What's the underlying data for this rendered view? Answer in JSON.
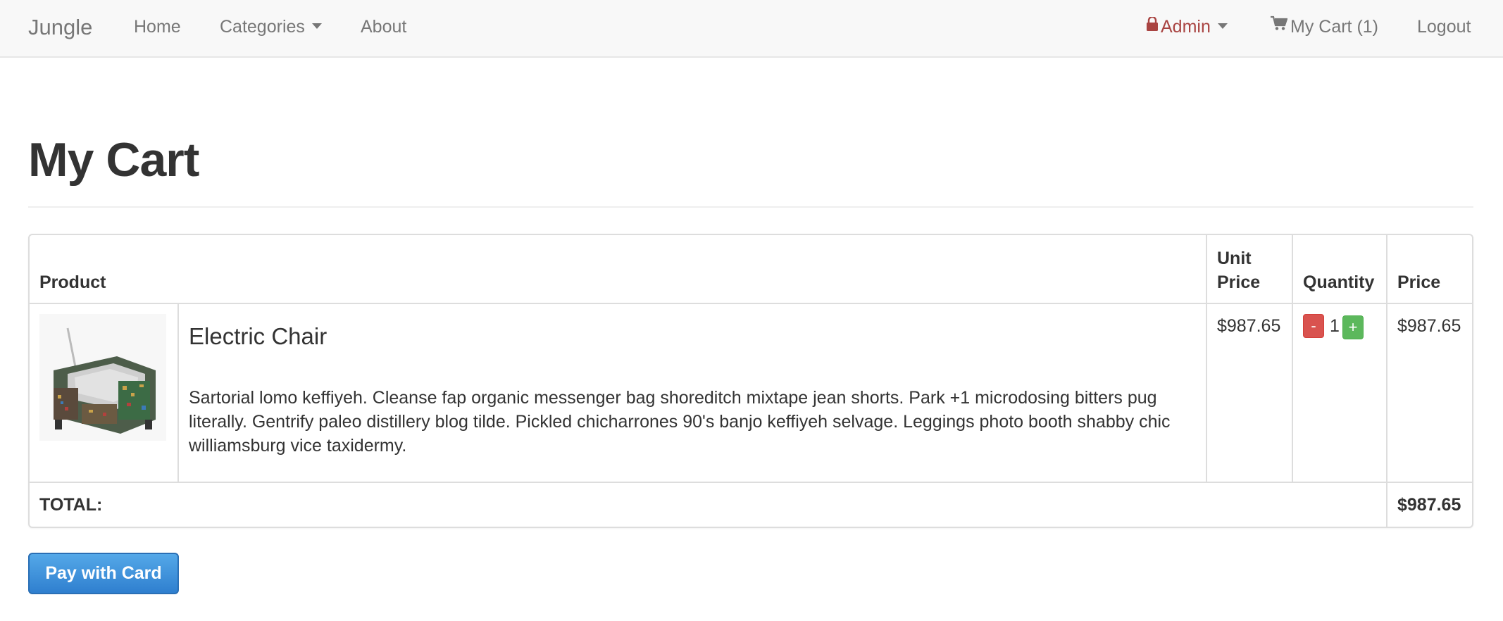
{
  "navbar": {
    "brand": "Jungle",
    "home": "Home",
    "categories": "Categories",
    "about": "About",
    "admin": "Admin",
    "cart": "My Cart (1)",
    "logout": "Logout",
    "icons": {
      "admin": "lock-icon",
      "cart": "shopping-cart-icon",
      "dropdown": "caret-down-icon"
    },
    "colors": {
      "admin": "#a94442",
      "link": "#777777",
      "background": "#f8f8f8"
    }
  },
  "page": {
    "title": "My Cart"
  },
  "table": {
    "headers": {
      "product": "Product",
      "unit_price_line1": "Unit",
      "unit_price_line2": "Price",
      "quantity": "Quantity",
      "price": "Price"
    },
    "rows": [
      {
        "name": "Electric Chair",
        "description": "Sartorial lomo keffiyeh. Cleanse fap organic messenger bag shoreditch mixtape jean shorts. Park +1 microdosing bitters pug literally. Gentrify paleo distillery blog tilde. Pickled chicharrones 90's banjo keffiyeh selvage. Leggings photo booth shabby chic williamsburg vice taxidermy.",
        "unit_price": "$987.65",
        "quantity": "1",
        "minus_label": "-",
        "plus_label": "+",
        "price": "$987.65"
      }
    ],
    "total_label": "TOTAL:",
    "total_value": "$987.65"
  },
  "pay_button": {
    "label": "Pay with Card",
    "color": "#3a8ee0"
  }
}
